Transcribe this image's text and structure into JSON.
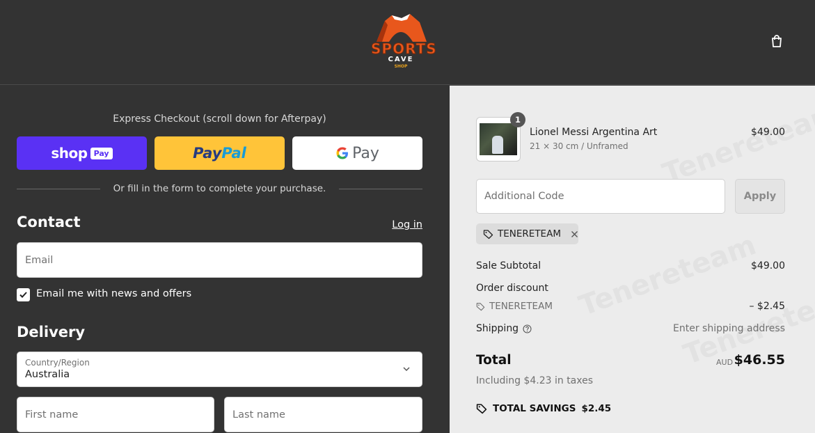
{
  "header": {
    "logo": {
      "line1": "SPORTS",
      "line2": "CAVE",
      "line3": "SHOP"
    },
    "cart_icon": "shopping-bag-icon"
  },
  "express": {
    "title": "Express Checkout (scroll down for Afterpay)",
    "shop_pay": {
      "word": "shop",
      "badge": "Pay",
      "color": "#5a31f4"
    },
    "paypal": {
      "part1": "Pay",
      "part2": "Pal",
      "color": "#ffc439"
    },
    "gpay": {
      "text": "Pay"
    },
    "divider_text": "Or fill in the form to complete your purchase."
  },
  "contact": {
    "title": "Contact",
    "login_link": "Log in",
    "email_placeholder": "Email",
    "news_checkbox": {
      "label": "Email me with news and offers",
      "checked": true
    }
  },
  "delivery": {
    "title": "Delivery",
    "country_label": "Country/Region",
    "country_value": "Australia",
    "first_name_placeholder": "First name",
    "last_name_placeholder": "Last name"
  },
  "order": {
    "item": {
      "name": "Lionel Messi Argentina Art",
      "variant": "21 × 30 cm / Unframed",
      "price": "$49.00",
      "quantity": "1"
    },
    "discount_code_placeholder": "Additional Code",
    "apply_label": "Apply",
    "applied_code": "TENERETEAM",
    "summary": {
      "subtotal_label": "Sale Subtotal",
      "subtotal_value": "$49.00",
      "discount_label": "Order discount",
      "discount_code": "TENERETEAM",
      "discount_value": "– $2.45",
      "shipping_label": "Shipping",
      "shipping_value": "Enter shipping address",
      "total_label": "Total",
      "total_currency": "AUD",
      "total_value": "$46.55",
      "tax_note": "Including $4.23 in taxes",
      "savings_label": "TOTAL SAVINGS",
      "savings_value": "$2.45"
    }
  },
  "watermark_text": "Tenereteam"
}
